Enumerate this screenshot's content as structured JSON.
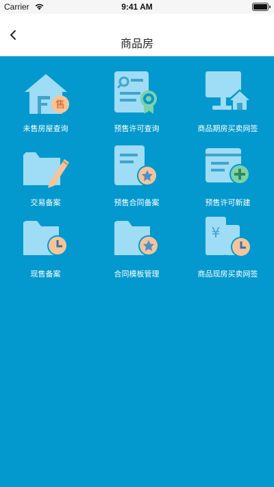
{
  "status_bar": {
    "carrier": "Carrier",
    "time": "9:41 AM"
  },
  "nav": {
    "title": "商品房"
  },
  "grid": {
    "items": [
      {
        "label": "未售房屋查询",
        "badge": "售"
      },
      {
        "label": "预售许可查询"
      },
      {
        "label": "商品期房买卖网签"
      },
      {
        "label": "交易备案"
      },
      {
        "label": "预售合同备案"
      },
      {
        "label": "预售许可新建"
      },
      {
        "label": "现售备案"
      },
      {
        "label": "合同模板管理"
      },
      {
        "label": "商品现房买卖网签",
        "badge": "¥"
      }
    ]
  },
  "colors": {
    "background": "#0399cf",
    "icon_light": "#9fdcf5",
    "icon_dark": "#3fa4cf",
    "badge_orange": "#f5c49a",
    "badge_green": "#7ed1a6",
    "badge_blue": "#4f8fc8"
  }
}
